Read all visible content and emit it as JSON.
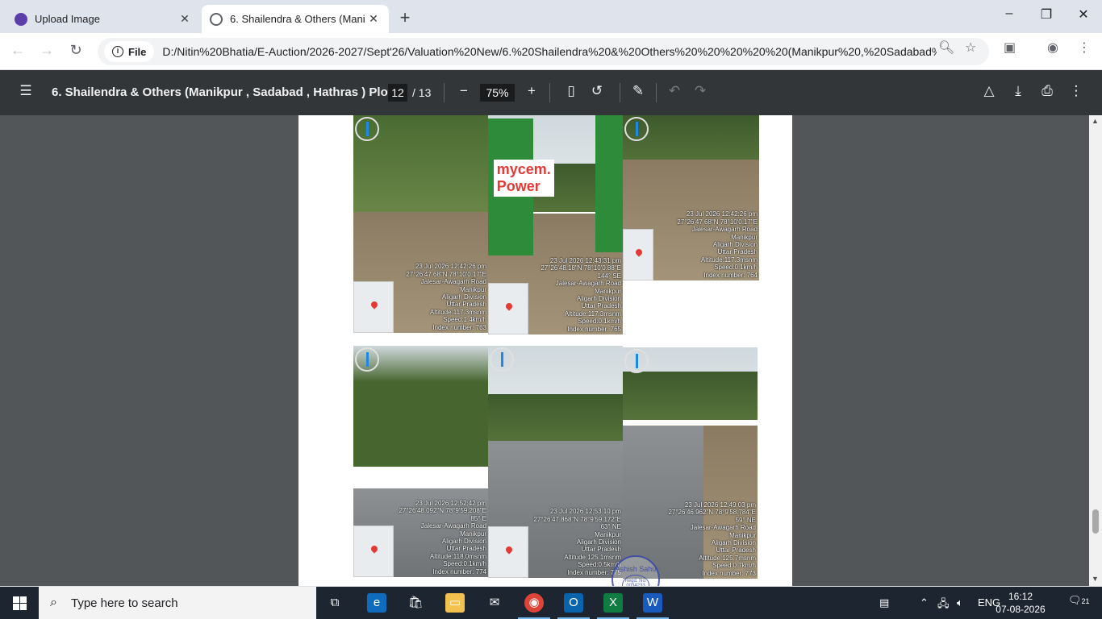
{
  "browser": {
    "tabs": [
      {
        "title": "Upload Image",
        "active": false
      },
      {
        "title": "6. Shailendra & Others   (Mani",
        "active": true
      }
    ],
    "new_tab": "+",
    "window_controls": {
      "minimize": "–",
      "maximize": "❐",
      "close": "✕"
    },
    "nav": {
      "back": "←",
      "forward": "→",
      "reload": "↻"
    },
    "address_chip": "File",
    "address_url": "D:/Nitin%20Bhatia/E-Auction/2026-2027/Sept'26/Valuation%20New/6.%20Shailendra%20&%20Others%20%20%20%20%20(Manikpur%20,%20Sadabad%..."
  },
  "pdf": {
    "title": "6. Shailendra & Others (Manikpur , Sadabad , Hathras ) Plot ...",
    "current_page": "12",
    "total_pages": "/ 13",
    "zoom": "75%"
  },
  "photos": [
    {
      "stamp": [
        "23 Jul 2026 12:42:26 pm",
        "27°26'47.68\"N 78°10'0.17\"E",
        "",
        "Jalesar-Awagarh Road",
        "Manikpur",
        "Aligarh Division",
        "Uttar Pradesh",
        "Altitude:117.3msnm",
        "Speed:1.4km/h",
        "Index number: 763"
      ]
    },
    {
      "stamp": [
        "23 Jul 2026 12:43:31 pm",
        "27°26'48.18\"N 78°10'0.88\"E",
        "144° SE",
        "Jalesar-Awagarh Road",
        "Manikpur",
        "Aligarh Division",
        "Uttar Pradesh",
        "Altitude:117.3msnm",
        "Speed:0.1km/h",
        "Index number: 765"
      ]
    },
    {
      "stamp": [
        "23 Jul 2026 12:42:26 pm",
        "27°26'47.68\"N 78°10'0.17\"E",
        "",
        "Jalesar-Awagarh Road",
        "Manikpur",
        "Aligarh Division",
        "Uttar Pradesh",
        "Altitude:117.3msnm",
        "Speed:0.1km/h",
        "Index number: 764"
      ]
    },
    {
      "stamp": [
        "23 Jul 2026 12:52:42 pm",
        "27°26'48.092\"N 78°9'59.208\"E",
        "85° E",
        "Jalesar-Awagarh Road",
        "Manikpur",
        "Aligarh Division",
        "Uttar Pradesh",
        "Altitude:118.0msnm",
        "Speed:0.1km/h",
        "Index number: 774"
      ]
    },
    {
      "stamp": [
        "23 Jul 2026 12:53:10 pm",
        "27°26'47.868\"N 78°9'59.172\"E",
        "63° NE",
        "Manikpur",
        "Aligarh Division",
        "Uttar Pradesh",
        "Altitude:125.1msnm",
        "Speed:0.5km/h",
        "Index number: 775"
      ]
    },
    {
      "stamp": [
        "23 Jul 2026 12:49:03 pm",
        "27°26'46.962\"N 78°9'58.784\"E",
        "59° NE",
        "Jalesar-Awagarh Road",
        "Manikpur",
        "Aligarh Division",
        "Uttar Pradesh",
        "Altitude:125.7msnm",
        "Speed:0.7km/h",
        "Index number: 773"
      ]
    }
  ],
  "board_text": "mycem. Power",
  "seal": {
    "name": "Ashish Sahu",
    "reg": "Regd. No. 0034233"
  },
  "taskbar": {
    "search_placeholder": "Type here to search",
    "language": "ENG",
    "time": "16:12",
    "date": "07-08-2026",
    "notifications": "21"
  }
}
